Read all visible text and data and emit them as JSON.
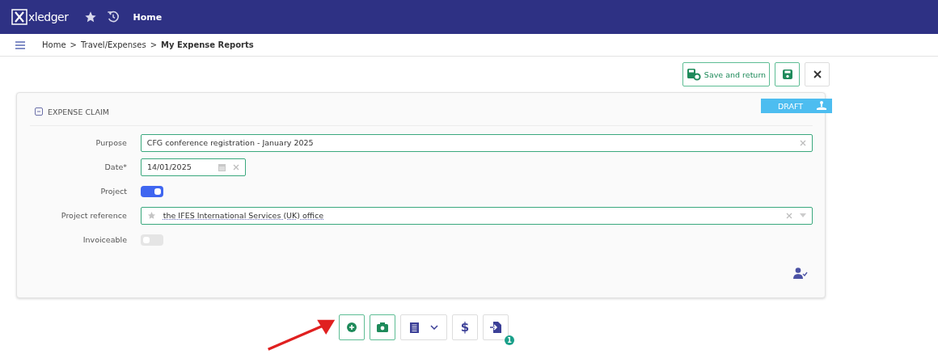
{
  "header": {
    "logo": "xledger",
    "title": "Home"
  },
  "breadcrumb": [
    "Home",
    "Travel/Expenses",
    "My Expense Reports"
  ],
  "breadcrumb_separator": ">",
  "toolbar": {
    "save_and_return": "Save and return"
  },
  "card": {
    "title": "EXPENSE CLAIM",
    "status": "DRAFT",
    "fields": [
      {
        "kind": "text",
        "label": "Purpose",
        "value": "CFG conference registration - January 2025"
      },
      {
        "kind": "date",
        "label": "Date*",
        "value": "14/01/2025"
      },
      {
        "kind": "toggle",
        "label": "Project",
        "on": true
      },
      {
        "kind": "lookup",
        "label": "Project reference",
        "value": "the IFES International Services (UK) office"
      },
      {
        "kind": "toggle",
        "label": "Invoiceable",
        "on": false
      }
    ]
  },
  "actions": [
    {
      "kind": "add",
      "primary": true
    },
    {
      "kind": "camera",
      "primary": true
    },
    {
      "kind": "document",
      "primary": false
    },
    {
      "kind": "dollar",
      "primary": false,
      "text": "$"
    },
    {
      "kind": "import",
      "primary": false,
      "badge": "1"
    }
  ]
}
